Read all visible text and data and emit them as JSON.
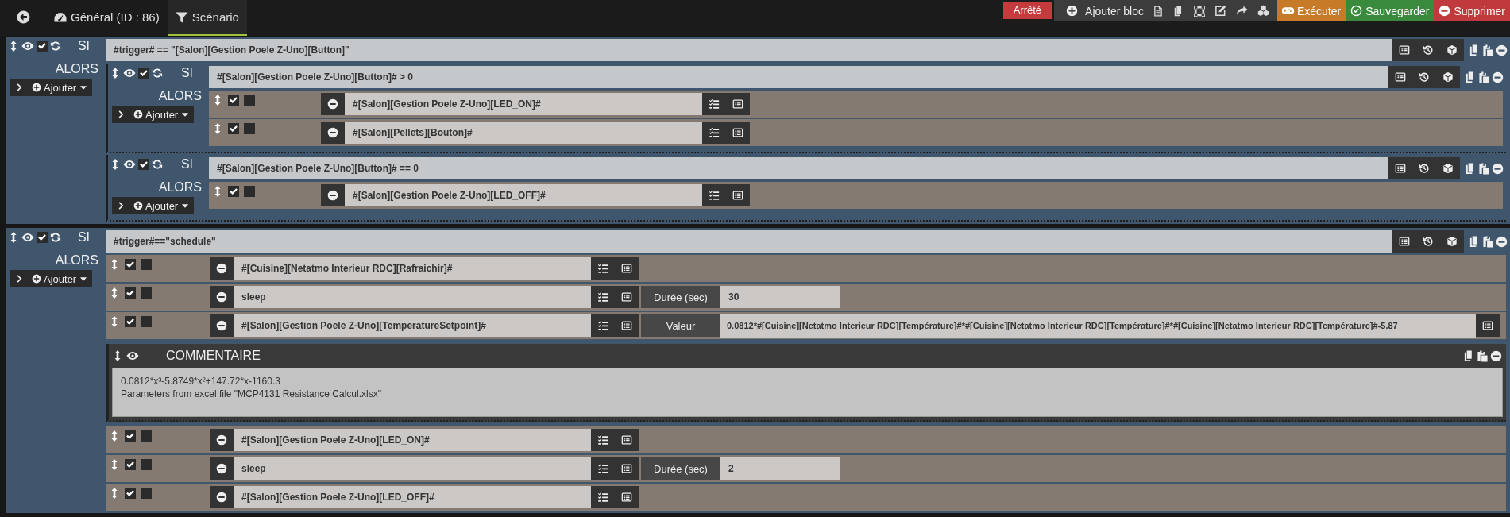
{
  "tabs": [
    {
      "label": "Général (ID : 86)",
      "kind": "general",
      "selected": false
    },
    {
      "label": "Scénario",
      "kind": "scenario",
      "selected": true
    }
  ],
  "status": "Arrêté",
  "add_block": "Ajouter bloc",
  "buttons": [
    {
      "label": "Exécuter",
      "kind": "run"
    },
    {
      "label": "Sauvegarder",
      "kind": "save"
    },
    {
      "label": "Supprimer",
      "kind": "delete"
    }
  ],
  "blocks": [
    {
      "kind": "if",
      "keyword": "SI",
      "enabled": true,
      "condition": "#trigger# == \"[Salon][Gestion Poele Z-Uno][Button]\"",
      "then_label": "ALORS",
      "add_label": "Ajouter",
      "children": [
        {
          "kind": "if",
          "keyword": "SI",
          "enabled": true,
          "condition": "#[Salon][Gestion Poele Z-Uno][Button]# > 0",
          "then_label": "ALORS",
          "add_label": "Ajouter",
          "children": [
            {
              "kind": "action",
              "enabled": true,
              "background": false,
              "command": "#[Salon][Gestion Poele Z-Uno][LED_ON]#"
            },
            {
              "kind": "action",
              "enabled": true,
              "background": false,
              "command": "#[Salon][Pellets][Bouton]#"
            }
          ]
        },
        {
          "kind": "if",
          "keyword": "SI",
          "enabled": true,
          "condition": "#[Salon][Gestion Poele Z-Uno][Button]# == 0",
          "then_label": "ALORS",
          "add_label": "Ajouter",
          "children": [
            {
              "kind": "action",
              "enabled": true,
              "background": false,
              "command": "#[Salon][Gestion Poele Z-Uno][LED_OFF]#"
            }
          ]
        }
      ]
    },
    {
      "kind": "if",
      "keyword": "SI",
      "enabled": true,
      "condition": "#trigger#==\"schedule\"",
      "then_label": "ALORS",
      "add_label": "Ajouter",
      "children": [
        {
          "kind": "action",
          "enabled": true,
          "background": false,
          "command": "#[Cuisine][Netatmo Interieur RDC][Rafraichir]#"
        },
        {
          "kind": "action",
          "enabled": true,
          "background": false,
          "command": "sleep",
          "option": {
            "kind": "short",
            "label": "Durée (sec)",
            "value": "30"
          }
        },
        {
          "kind": "action",
          "enabled": true,
          "background": false,
          "command": "#[Salon][Gestion Poele Z-Uno][TemperatureSetpoint]#",
          "option": {
            "kind": "expression",
            "label": "Valeur",
            "value": "0.0812*#[Cuisine][Netatmo Interieur RDC][Température]#*#[Cuisine][Netatmo Interieur RDC][Température]#*#[Cuisine][Netatmo Interieur RDC][Température]#-5.87"
          }
        },
        {
          "kind": "comment",
          "title": "COMMENTAIRE",
          "lines": [
            "0.0812*x³-5.8749*x²+147.72*x-1160.3",
            "Parameters from excel file \"MCP4131 Resistance Calcul.xlsx\""
          ]
        },
        {
          "kind": "action",
          "enabled": true,
          "background": false,
          "command": "#[Salon][Gestion Poele Z-Uno][LED_ON]#"
        },
        {
          "kind": "action",
          "enabled": true,
          "background": false,
          "command": "sleep",
          "option": {
            "kind": "short",
            "label": "Durée (sec)",
            "value": "2"
          }
        },
        {
          "kind": "action",
          "enabled": true,
          "background": false,
          "command": "#[Salon][Gestion Poele Z-Uno][LED_OFF]#"
        }
      ]
    }
  ]
}
